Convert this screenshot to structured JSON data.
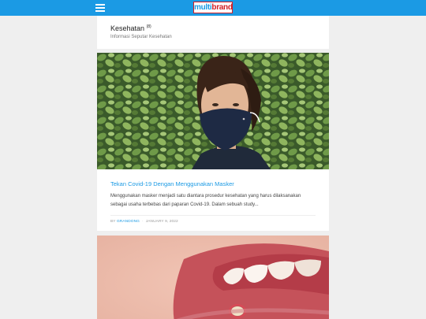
{
  "header": {
    "menu_icon": "hamburger-menu-icon",
    "logo_part1": "multi",
    "logo_part2": "brand"
  },
  "category": {
    "title": "Kesehatan",
    "count": "(8)",
    "description": "Informasi Seputar Kesehatan"
  },
  "posts": [
    {
      "title": "Tekan Covid-19 Dengan Menggunakan Masker",
      "excerpt": "Menggunakan masker menjadi satu diantara prosedur kesehatan yang harus dilaksanakan sebagai usaha terbebas dari paparan Covid-19. Dalam sebuah study...",
      "author_prefix": "BY",
      "author": "GRANDONG",
      "date": "JANUARY 9, 2022"
    }
  ],
  "colors": {
    "accent": "#1b9ae4",
    "logo_red": "#d32027",
    "background": "#efefef"
  }
}
